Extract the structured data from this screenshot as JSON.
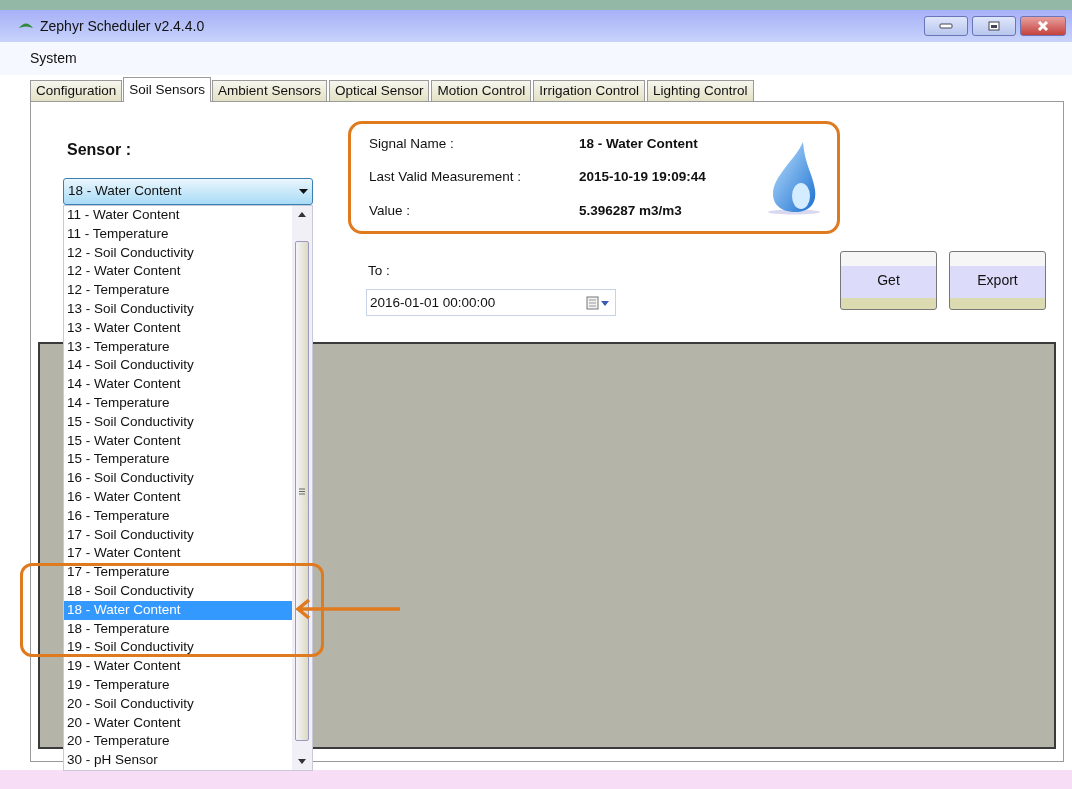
{
  "window": {
    "title": "Zephyr Scheduler v2.4.4.0"
  },
  "menu": [
    "System"
  ],
  "tabs": [
    {
      "label": "Configuration",
      "selected": false
    },
    {
      "label": "Soil Sensors",
      "selected": true
    },
    {
      "label": "Ambient Sensors",
      "selected": false
    },
    {
      "label": "Optical Sensor",
      "selected": false
    },
    {
      "label": "Motion Control",
      "selected": false
    },
    {
      "label": "Irrigation Control",
      "selected": false
    },
    {
      "label": "Lighting Control",
      "selected": false
    }
  ],
  "sensor": {
    "label": "Sensor :",
    "value": "18 - Water Content",
    "options": [
      {
        "label": "11 - Water Content",
        "selected": false
      },
      {
        "label": "11 - Temperature",
        "selected": false
      },
      {
        "label": "12 - Soil Conductivity",
        "selected": false
      },
      {
        "label": "12 - Water Content",
        "selected": false
      },
      {
        "label": "12 - Temperature",
        "selected": false
      },
      {
        "label": "13 - Soil Conductivity",
        "selected": false
      },
      {
        "label": "13 - Water Content",
        "selected": false
      },
      {
        "label": "13 - Temperature",
        "selected": false
      },
      {
        "label": "14 - Soil Conductivity",
        "selected": false
      },
      {
        "label": "14 - Water Content",
        "selected": false
      },
      {
        "label": "14 - Temperature",
        "selected": false
      },
      {
        "label": "15 - Soil Conductivity",
        "selected": false
      },
      {
        "label": "15 - Water Content",
        "selected": false
      },
      {
        "label": "15 - Temperature",
        "selected": false
      },
      {
        "label": "16 - Soil Conductivity",
        "selected": false
      },
      {
        "label": "16 - Water Content",
        "selected": false
      },
      {
        "label": "16 - Temperature",
        "selected": false
      },
      {
        "label": "17 - Soil Conductivity",
        "selected": false
      },
      {
        "label": "17 - Water Content",
        "selected": false
      },
      {
        "label": "17 - Temperature",
        "selected": false
      },
      {
        "label": "18 - Soil Conductivity",
        "selected": false
      },
      {
        "label": "18 - Water Content",
        "selected": true
      },
      {
        "label": "18 - Temperature",
        "selected": false
      },
      {
        "label": "19 - Soil Conductivity",
        "selected": false
      },
      {
        "label": "19 - Water Content",
        "selected": false
      },
      {
        "label": "19 - Temperature",
        "selected": false
      },
      {
        "label": "20 - Soil Conductivity",
        "selected": false
      },
      {
        "label": "20 - Water Content",
        "selected": false
      },
      {
        "label": "20 - Temperature",
        "selected": false
      },
      {
        "label": "30 - pH Sensor",
        "selected": false
      }
    ]
  },
  "info": [
    {
      "label": "Signal Name :",
      "value": "18 - Water Content"
    },
    {
      "label": "Last Valid Measurement :",
      "value": "2015-10-19 19:09:44"
    },
    {
      "label": "Value :",
      "value": "5.396287 m3/m3"
    }
  ],
  "to": {
    "label": "To :",
    "value": "2016-01-01 00:00:00"
  },
  "buttons": [
    "Get",
    "Export"
  ]
}
